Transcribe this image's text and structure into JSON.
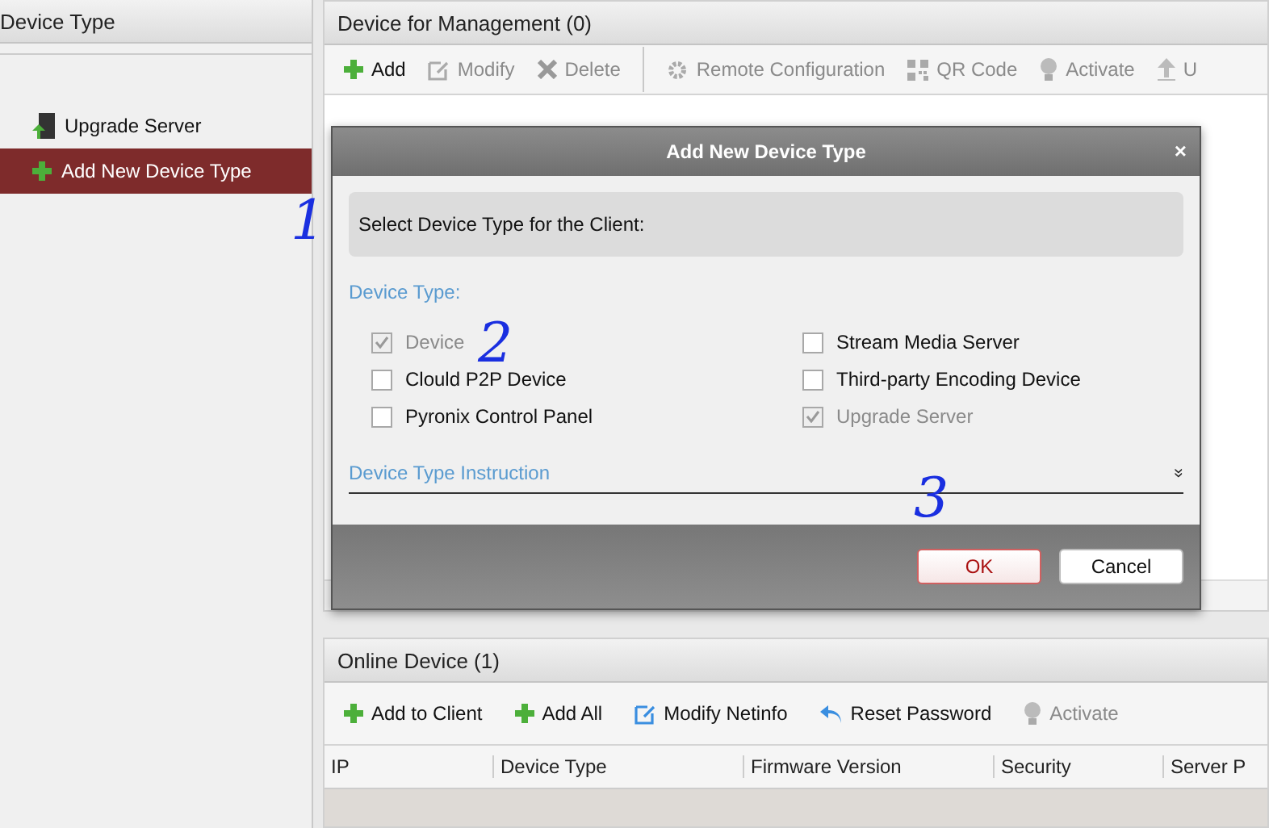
{
  "left_panel": {
    "title": "Device Type",
    "tree": [
      {
        "label": "Upgrade Server",
        "kind": "server",
        "selected": false
      },
      {
        "label": "Add New Device Type",
        "kind": "add",
        "selected": true
      }
    ]
  },
  "management": {
    "title": "Device for Management (0)",
    "toolbar": [
      {
        "label": "Add",
        "kind": "add",
        "disabled": false
      },
      {
        "label": "Modify",
        "kind": "edit",
        "disabled": true
      },
      {
        "label": "Delete",
        "kind": "delete",
        "disabled": true
      },
      {
        "label": "Remote Configuration",
        "kind": "gear",
        "disabled": true
      },
      {
        "label": "QR Code",
        "kind": "qr",
        "disabled": true
      },
      {
        "label": "Activate",
        "kind": "bulb",
        "disabled": true
      },
      {
        "label": "U",
        "kind": "upload",
        "disabled": true
      }
    ]
  },
  "online": {
    "title": "Online Device (1)",
    "toolbar": [
      {
        "label": "Add to Client",
        "kind": "add",
        "disabled": false
      },
      {
        "label": "Add All",
        "kind": "add",
        "disabled": false
      },
      {
        "label": "Modify Netinfo",
        "kind": "edit",
        "disabled": false
      },
      {
        "label": "Reset Password",
        "kind": "undo",
        "disabled": false
      },
      {
        "label": "Activate",
        "kind": "bulb",
        "disabled": true
      }
    ],
    "columns": [
      "IP",
      "Device Type",
      "Firmware Version",
      "Security",
      "Server P"
    ]
  },
  "dialog": {
    "title": "Add New Device Type",
    "close": "×",
    "prompt": "Select Device Type for the Client:",
    "section": "Device Type:",
    "options": [
      {
        "label": "Device",
        "checked": true,
        "disabled": true
      },
      {
        "label": "Stream Media Server",
        "checked": false,
        "disabled": false
      },
      {
        "label": "Clould P2P Device",
        "checked": false,
        "disabled": false
      },
      {
        "label": "Third-party Encoding Device",
        "checked": false,
        "disabled": false
      },
      {
        "label": "Pyronix Control Panel",
        "checked": false,
        "disabled": false
      },
      {
        "label": "Upgrade Server",
        "checked": true,
        "disabled": true
      }
    ],
    "instruction": "Device Type Instruction",
    "expand": "»",
    "buttons": [
      {
        "label": "OK",
        "kind": "primary"
      },
      {
        "label": "Cancel",
        "kind": "secondary"
      }
    ]
  },
  "annotations": [
    "1",
    "2",
    "3"
  ]
}
